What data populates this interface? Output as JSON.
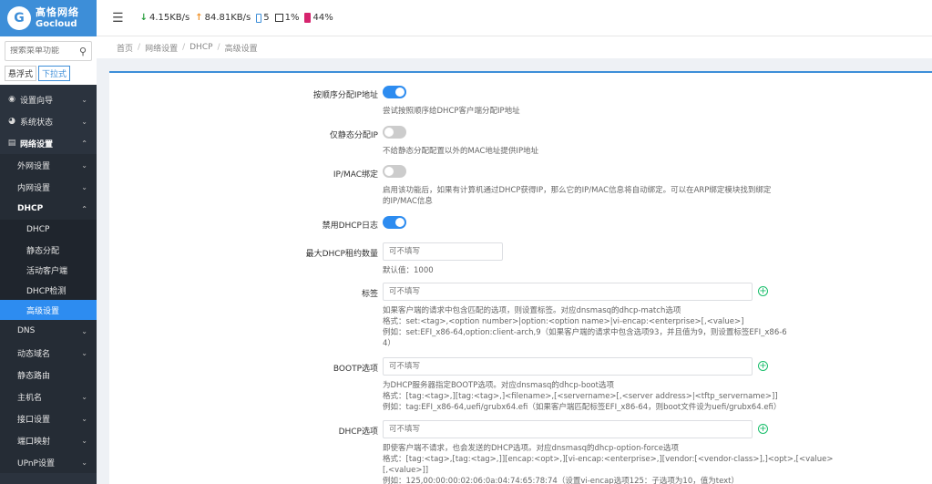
{
  "brand": {
    "mark": "G",
    "name_cn": "高恪网络",
    "name_en": "Gocloud"
  },
  "search": {
    "placeholder": "搜索菜单功能"
  },
  "modes": {
    "float": "悬浮式",
    "dropdown": "下拉式"
  },
  "menu": {
    "wizard": "设置向导",
    "status": "系统状态",
    "network": "网络设置",
    "wan": "外网设置",
    "lan": "内网设置",
    "dhcp": "DHCP",
    "dhcp_sub": [
      "DHCP",
      "静态分配",
      "活动客户端",
      "DHCP检测",
      "高级设置"
    ],
    "dns": "DNS",
    "ddns": "动态域名",
    "static_route": "静态路由",
    "hostname": "主机名",
    "interface": "接口设置",
    "port_map": "端口映射",
    "upnp": "UPnP设置"
  },
  "topbar": {
    "down": "4.15KB/s",
    "up": "84.81KB/s",
    "clients": "5",
    "cpu": "1%",
    "mem": "44%"
  },
  "breadcrumb": [
    "首页",
    "网络设置",
    "DHCP",
    "高级设置"
  ],
  "form": {
    "sequential": {
      "label": "按顺序分配IP地址",
      "on": true,
      "help": "尝试按照顺序给DHCP客户端分配IP地址"
    },
    "static_only": {
      "label": "仅静态分配IP",
      "on": false,
      "help": "不给静态分配配置以外的MAC地址提供IP地址"
    },
    "ipmac": {
      "label": "IP/MAC绑定",
      "on": false,
      "help1": "启用该功能后，如果有计算机通过DHCP获得IP，那么它的IP/MAC信息将自动绑定。可以在ARP绑定模块找到绑定",
      "help2": "的IP/MAC信息"
    },
    "log": {
      "label": "禁用DHCP日志",
      "on": true
    },
    "max_leases": {
      "label": "最大DHCP租约数量",
      "placeholder": "可不填写",
      "help": "默认值：1000"
    },
    "tag": {
      "label": "标签",
      "placeholder": "可不填写",
      "help1": "如果客户端的请求中包含匹配的选项，则设置标签。对应dnsmasq的dhcp-match选项",
      "help2": "格式：set:<tag>,<option number>|option:<option name>|vi-encap:<enterprise>[,<value>]",
      "help3": "例如：set:EFI_x86-64,option:client-arch,9（如果客户端的请求中包含选项93，并且值为9，则设置标签EFI_x86-6",
      "help4": "4）"
    },
    "bootp": {
      "label": "BOOTP选项",
      "placeholder": "可不填写",
      "help1": "为DHCP服务器指定BOOTP选项。对应dnsmasq的dhcp-boot选项",
      "help2": "格式：[tag:<tag>,][tag:<tag>,]<filename>,[<servername>[,<server address>|<tftp_servername>]]",
      "help3": "例如：tag:EFI_x86-64,uefi/grubx64.efi（如果客户端匹配标签EFI_x86-64，则boot文件设为uefi/grubx64.efi）"
    },
    "dhcp_opt": {
      "label": "DHCP选项",
      "placeholder": "可不填写",
      "help1": "即使客户端不请求，也会发送的DHCP选项。对应dnsmasq的dhcp-option-force选项",
      "help2": "格式：[tag:<tag>,[tag:<tag>,]][encap:<opt>,][vi-encap:<enterprise>,][vendor:[<vendor-class>],]<opt>,[<value>",
      "help3": "[,<value>]]",
      "help4": "例如：125,00:00:00:02:06:0a:04:74:65:78:74（设置vi-encap选项125：子选项为10，值为text）"
    }
  }
}
